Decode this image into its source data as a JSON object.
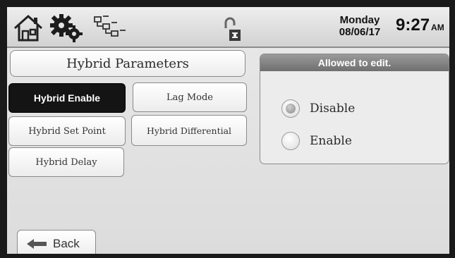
{
  "header": {
    "day": "Monday",
    "date": "08/06/17",
    "time": "9:27",
    "ampm": "AM",
    "icons": [
      "home-icon",
      "gear-icon",
      "network-icon",
      "lock-icon"
    ]
  },
  "parameters": {
    "title": "Hybrid Parameters",
    "buttons": {
      "hybrid_enable": "Hybrid Enable",
      "lag_mode": "Lag Mode",
      "hybrid_set_point": "Hybrid Set Point",
      "hybrid_differential": "Hybrid Differential",
      "hybrid_delay": "Hybrid Delay"
    },
    "selected": "Hybrid Enable"
  },
  "edit_panel": {
    "header": "Allowed to edit.",
    "options": [
      "Disable",
      "Enable"
    ],
    "selected": "Disable"
  },
  "footer": {
    "back_label": "Back"
  },
  "colors": {
    "selected_button": "#141414",
    "panel_header": "#7f7f7f",
    "background": "#e2e2e2"
  }
}
